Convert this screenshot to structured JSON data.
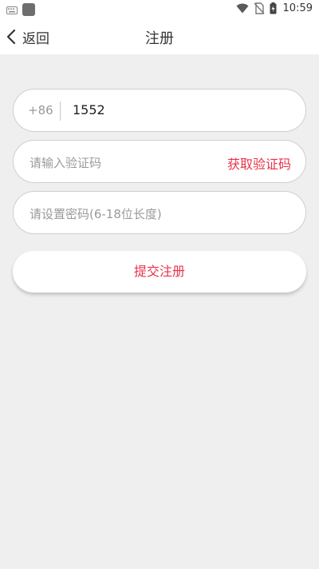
{
  "status_bar": {
    "time": "10:59",
    "icons": [
      "keyboard-icon",
      "app-notification-icon",
      "wifi-icon",
      "no-sim-icon",
      "battery-charging-icon"
    ]
  },
  "header": {
    "back_label": "返回",
    "title": "注册"
  },
  "form": {
    "country_code": "+86",
    "phone_value": "1552",
    "code_placeholder": "请输入验证码",
    "get_code_label": "获取验证码",
    "password_placeholder": "请设置密码(6-18位长度)"
  },
  "submit": {
    "label": "提交注册"
  },
  "colors": {
    "accent": "#e8334a",
    "background": "#efefef",
    "surface": "#ffffff"
  }
}
